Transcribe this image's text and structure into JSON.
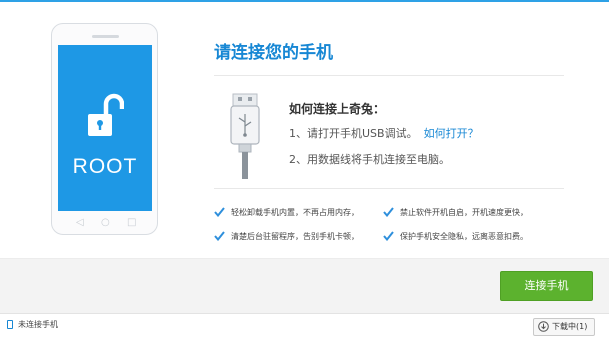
{
  "phone": {
    "screen_label": "ROOT",
    "screen_color": "#1e98e5"
  },
  "main": {
    "title": "请连接您的手机",
    "howto_title": "如何连接上奇兔：",
    "step1": "1、请打开手机USB调试。",
    "step1_link": "如何打开？",
    "step2": "2、用数据线将手机连接至电脑。"
  },
  "features": [
    "轻松卸载手机内置，不再占用内存，",
    "禁止软件开机自启，开机速度更快，",
    "清楚后台驻留程序，告别手机卡顿，",
    "保护手机安全隐私，远离恶意扣费。"
  ],
  "actions": {
    "connect_label": "连接手机",
    "connect_color": "#5cb22e"
  },
  "statusbar": {
    "status_text": "未连接手机",
    "download_label": "下载中(1)"
  },
  "colors": {
    "accent": "#1787d4",
    "check": "#2e8fdc"
  },
  "icons": [
    "unlock-icon",
    "usb-cable-icon",
    "check-icon",
    "phone-status-icon",
    "download-icon"
  ]
}
